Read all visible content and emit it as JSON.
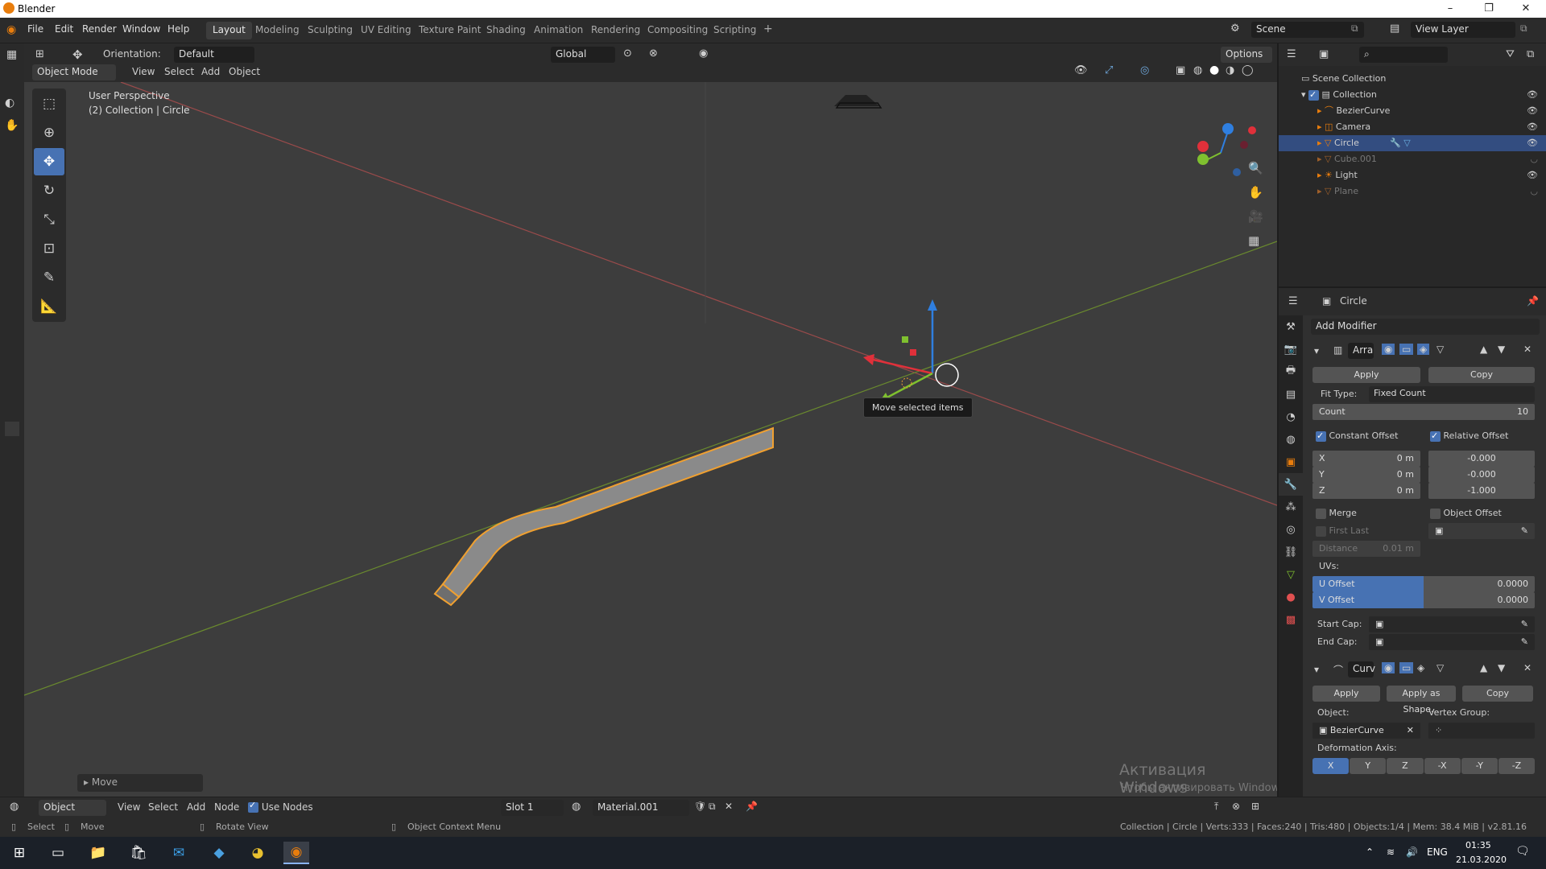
{
  "window": {
    "title": "Blender",
    "minimize": "–",
    "maximize": "❐",
    "close": "✕"
  },
  "topbar": {
    "menus": [
      "File",
      "Edit",
      "Render",
      "Window",
      "Help"
    ],
    "workspaces": [
      "Layout",
      "Modeling",
      "Sculpting",
      "UV Editing",
      "Texture Paint",
      "Shading",
      "Animation",
      "Rendering",
      "Compositing",
      "Scripting"
    ],
    "add_ws": "+",
    "scene_label": "Scene",
    "view_layer_label": "View Layer"
  },
  "viewport_header": {
    "orientation_label": "Orientation:",
    "orientation_value": "Default",
    "transform_value": "Global",
    "options": "Options",
    "mode": "Object Mode",
    "menus": [
      "View",
      "Select",
      "Add",
      "Object"
    ]
  },
  "viewport": {
    "perspective": "User Perspective",
    "context": "(2) Collection | Circle",
    "tooltip": "Move selected items",
    "last_op": "Move",
    "watermark_title": "Активация Windows",
    "watermark_sub": "Чтобы активировать Windows, перейдите в раздел \"Параметры\"."
  },
  "outliner": {
    "root": "Scene Collection",
    "collection": "Collection",
    "items": [
      {
        "name": "BezierCurve",
        "selected": false,
        "dim": false
      },
      {
        "name": "Camera",
        "selected": false,
        "dim": false
      },
      {
        "name": "Circle",
        "selected": true,
        "dim": false
      },
      {
        "name": "Cube.001",
        "selected": false,
        "dim": true
      },
      {
        "name": "Light",
        "selected": false,
        "dim": false
      },
      {
        "name": "Plane",
        "selected": false,
        "dim": true
      }
    ]
  },
  "properties": {
    "object_name": "Circle",
    "add_modifier": "Add Modifier",
    "array": {
      "name": "Arra",
      "apply": "Apply",
      "copy": "Copy",
      "fit_type_label": "Fit Type:",
      "fit_type_value": "Fixed Count",
      "count_label": "Count",
      "count_value": "10",
      "constant_offset": "Constant Offset",
      "relative_offset": "Relative Offset",
      "const_x_label": "X",
      "const_x": "0 m",
      "const_y_label": "Y",
      "const_y": "0 m",
      "const_z_label": "Z",
      "const_z": "0 m",
      "rel_x": "-0.000",
      "rel_y": "-0.000",
      "rel_z": "-1.000",
      "merge": "Merge",
      "object_offset": "Object Offset",
      "first_last": "First Last",
      "distance_label": "Distance",
      "distance_value": "0.01 m",
      "uvs_label": "UVs:",
      "u_offset_label": "U Offset",
      "u_offset": "0.0000",
      "v_offset_label": "V Offset",
      "v_offset": "0.0000",
      "start_cap": "Start Cap:",
      "end_cap": "End Cap:"
    },
    "curve": {
      "name": "Curv",
      "apply": "Apply",
      "apply_shape": "Apply as Shape...",
      "copy": "Copy",
      "object_label": "Object:",
      "object_value": "BezierCurve",
      "vertex_group_label": "Vertex Group:",
      "deform_axis_label": "Deformation Axis:",
      "axes": [
        "X",
        "Y",
        "Z",
        "-X",
        "-Y",
        "-Z"
      ]
    }
  },
  "bottom_header": {
    "mode": "Object",
    "menus": [
      "View",
      "Select",
      "Add",
      "Node"
    ],
    "use_nodes": "Use Nodes",
    "slot": "Slot 1",
    "material": "Material.001"
  },
  "statusbar": {
    "select": "Select",
    "move": "Move",
    "rotate": "Rotate View",
    "context_menu": "Object Context Menu",
    "stats": "Collection | Circle | Verts:333 | Faces:240 | Tris:480 | Objects:1/4 | Mem: 38.4 MiB | v2.81.16"
  },
  "taskbar": {
    "lang": "ENG",
    "time": "01:35",
    "date": "21.03.2020"
  }
}
